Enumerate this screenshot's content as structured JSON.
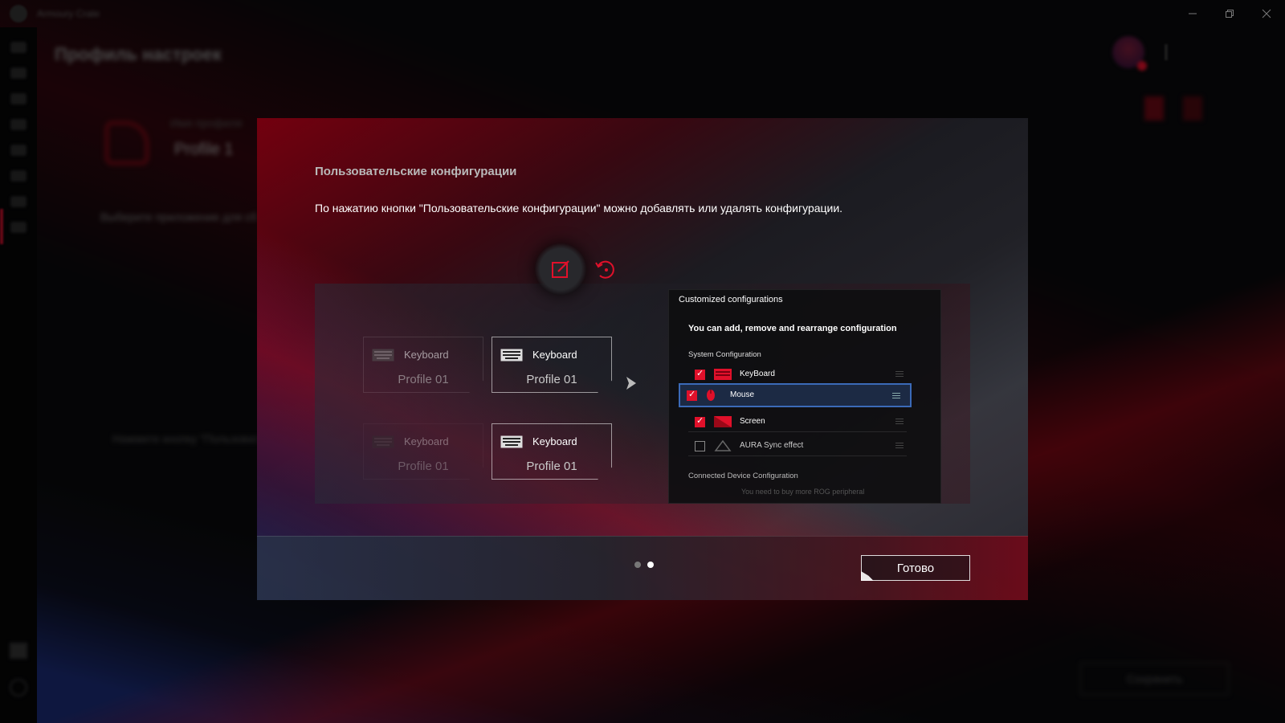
{
  "window": {
    "app_title": "Armoury Crate",
    "controls": [
      "minimize",
      "maximize",
      "close"
    ]
  },
  "background": {
    "heading": "Профиль настроек",
    "profile_label": "Имя профиля",
    "profile_name": "Profile 1",
    "hint_line": "Выберите приложение для сб",
    "hint_paragraph": "Нажмите кнопку \"Пользоват... ...на для\nприложения, в которое ...",
    "save_button": "Сохранить"
  },
  "modal": {
    "title": "Пользовательские конфигурации",
    "description": "По нажатию кнопки \"Пользовательские конфигурации\" можно добавлять или удалять конфигурации.",
    "cards": [
      {
        "name": "Keyboard",
        "sub": "Profile 01"
      },
      {
        "name": "Keyboard",
        "sub": "Profile 01"
      },
      {
        "name": "Keyboard",
        "sub": "Profile 01"
      },
      {
        "name": "Keyboard",
        "sub": "Profile 01"
      }
    ],
    "config_panel": {
      "title": "Customized configurations",
      "subtitle": "You can add, remove and rearrange configuration",
      "system_group": "System Configuration",
      "items": [
        {
          "label": "KeyBoard",
          "checked": true,
          "icon": "keyboard-icon"
        },
        {
          "label": "Mouse",
          "checked": true,
          "icon": "mouse-icon",
          "selected": true
        },
        {
          "label": "Screen",
          "checked": true,
          "icon": "screen-icon"
        },
        {
          "label": "AURA Sync effect",
          "checked": false,
          "icon": "aura-icon"
        }
      ],
      "connected_group": "Connected Device Configuration",
      "note": "You need to buy more ROG peripheral"
    },
    "pager": {
      "current": 2,
      "total": 2
    },
    "done_button": "Готово"
  },
  "colors": {
    "accent_red": "#e0102a",
    "selection_blue": "#3b6ab8"
  }
}
